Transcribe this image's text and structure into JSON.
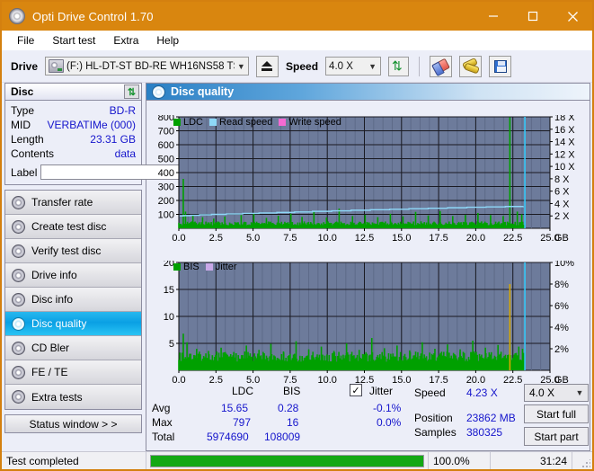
{
  "window": {
    "title": "Opti Drive Control 1.70",
    "icon": "disc-icon",
    "minimize": "minimize-icon",
    "maximize": "maximize-icon",
    "close": "close-icon"
  },
  "menu": [
    "File",
    "Start test",
    "Extra",
    "Help"
  ],
  "toolbar": {
    "drive_label": "Drive",
    "drive_value": "(F:)  HL-DT-ST BD-RE  WH16NS58 TST4",
    "eject_icon": "eject-icon",
    "speed_label": "Speed",
    "speed_value": "4.0 X",
    "refresh_icon": "refresh-icon",
    "eraser_icon": "eraser-icon",
    "tools_icon": "tools-icon",
    "save_icon": "save-icon"
  },
  "disc_panel": {
    "title": "Disc",
    "refresh_icon": "refresh-icon",
    "rows": [
      {
        "key": "Type",
        "value": "BD-R"
      },
      {
        "key": "MID",
        "value": "VERBATIMe (000)"
      },
      {
        "key": "Length",
        "value": "23.31 GB"
      },
      {
        "key": "Contents",
        "value": "data"
      }
    ],
    "label_key": "Label",
    "label_value": "",
    "label_placeholder": "",
    "disc_button_icon": "cd-icon"
  },
  "sidebar": {
    "items": [
      {
        "label": "Transfer rate",
        "active": false
      },
      {
        "label": "Create test disc",
        "active": false
      },
      {
        "label": "Verify test disc",
        "active": false
      },
      {
        "label": "Drive info",
        "active": false
      },
      {
        "label": "Disc info",
        "active": false
      },
      {
        "label": "Disc quality",
        "active": true
      },
      {
        "label": "CD Bler",
        "active": false
      },
      {
        "label": "FE / TE",
        "active": false
      },
      {
        "label": "Extra tests",
        "active": false
      }
    ],
    "status_window": "Status window > >"
  },
  "main": {
    "header": "Disc quality",
    "header_icon": "disc-quality-icon"
  },
  "chart_data": [
    {
      "id": "top-chart",
      "type": "area",
      "title": "",
      "xlabel": "GB",
      "ylabel": "",
      "xlim": [
        0.0,
        25.0
      ],
      "xticks": [
        "0.0",
        "2.5",
        "5.0",
        "7.5",
        "10.0",
        "12.5",
        "15.0",
        "17.5",
        "20.0",
        "22.5",
        "25.0"
      ],
      "x_unit": "GB",
      "ylim": [
        0,
        800
      ],
      "yticks": [
        "800",
        "700",
        "600",
        "500",
        "400",
        "300",
        "200",
        "100"
      ],
      "y2lim": [
        0,
        18
      ],
      "y2ticks": [
        "18 X",
        "16 X",
        "14 X",
        "12 X",
        "10 X",
        "8 X",
        "6 X",
        "4 X",
        "2 X"
      ],
      "grid": true,
      "legend_position": "top-left",
      "legend": [
        {
          "name": "LDC",
          "color": "#00a000"
        },
        {
          "name": "Read speed",
          "color": "#8ed8f8"
        },
        {
          "name": "Write speed",
          "color": "#f56ad2"
        }
      ],
      "series": [
        {
          "name": "LDC",
          "color": "#00a000",
          "axis": "left",
          "render": "spikes",
          "baseline": 22,
          "noise_amplitude": 28,
          "spikes": [
            [
              0.3,
              355
            ],
            [
              0.45,
              120
            ],
            [
              0.95,
              95
            ],
            [
              1.6,
              80
            ],
            [
              2.35,
              70
            ],
            [
              3.1,
              85
            ],
            [
              4.2,
              95
            ],
            [
              5.05,
              110
            ],
            [
              5.9,
              75
            ],
            [
              6.7,
              90
            ],
            [
              7.55,
              105
            ],
            [
              8.3,
              82
            ],
            [
              9.1,
              120
            ],
            [
              9.95,
              78
            ],
            [
              10.8,
              142
            ],
            [
              11.7,
              88
            ],
            [
              12.55,
              96
            ],
            [
              13.4,
              80
            ],
            [
              14.25,
              104
            ],
            [
              15.1,
              86
            ],
            [
              15.95,
              118
            ],
            [
              16.8,
              92
            ],
            [
              17.6,
              124
            ],
            [
              18.45,
              88
            ],
            [
              19.3,
              96
            ],
            [
              20.15,
              110
            ],
            [
              21.0,
              95
            ],
            [
              21.85,
              88
            ],
            [
              22.3,
              797
            ],
            [
              22.8,
              120
            ],
            [
              23.1,
              100
            ]
          ],
          "x_end": 23.31
        },
        {
          "name": "Read speed",
          "color": "#8ed8f8",
          "axis": "right",
          "render": "step-line",
          "points": [
            [
              0.05,
              2.0
            ],
            [
              0.3,
              2.05
            ],
            [
              0.8,
              2.1
            ],
            [
              1.4,
              2.18
            ],
            [
              2.2,
              2.25
            ],
            [
              3.2,
              2.32
            ],
            [
              4.3,
              2.4
            ],
            [
              5.4,
              2.48
            ],
            [
              6.6,
              2.56
            ],
            [
              7.8,
              2.64
            ],
            [
              9.0,
              2.74
            ],
            [
              10.3,
              2.82
            ],
            [
              11.6,
              2.92
            ],
            [
              12.9,
              3.0
            ],
            [
              14.2,
              3.08
            ],
            [
              15.5,
              3.16
            ],
            [
              16.8,
              3.24
            ],
            [
              18.1,
              3.32
            ],
            [
              19.4,
              3.4
            ],
            [
              20.7,
              3.46
            ],
            [
              22.0,
              3.52
            ],
            [
              23.2,
              3.56
            ]
          ]
        },
        {
          "name": "Write speed",
          "color": "#f56ad2",
          "axis": "right",
          "render": "none",
          "points": []
        }
      ],
      "markers": [
        {
          "name": "end-of-data",
          "x": 23.31,
          "color": "#35c8f8"
        }
      ]
    },
    {
      "id": "bottom-chart",
      "type": "area",
      "title": "",
      "xlabel": "GB",
      "ylabel": "",
      "xlim": [
        0.0,
        25.0
      ],
      "xticks": [
        "0.0",
        "2.5",
        "5.0",
        "7.5",
        "10.0",
        "12.5",
        "15.0",
        "17.5",
        "20.0",
        "22.5",
        "25.0"
      ],
      "x_unit": "GB",
      "ylim": [
        0,
        20
      ],
      "yticks": [
        "20",
        "15",
        "10",
        "5"
      ],
      "y2lim": [
        0,
        10
      ],
      "y2ticks": [
        "10%",
        "8%",
        "6%",
        "4%",
        "2%"
      ],
      "grid": true,
      "legend_position": "top-left",
      "legend": [
        {
          "name": "BIS",
          "color": "#00a000"
        },
        {
          "name": "Jitter",
          "color": "#c9a8e8"
        }
      ],
      "series": [
        {
          "name": "BIS",
          "color": "#00a000",
          "axis": "left",
          "render": "spikes",
          "baseline": 1.6,
          "noise_amplitude": 1.9,
          "spikes": [
            [
              0.3,
              6.8
            ],
            [
              0.55,
              5.2
            ],
            [
              1.2,
              4.0
            ],
            [
              2.0,
              3.6
            ],
            [
              2.85,
              4.2
            ],
            [
              3.7,
              3.4
            ],
            [
              4.55,
              4.6
            ],
            [
              5.4,
              3.8
            ],
            [
              6.2,
              4.9
            ],
            [
              7.05,
              3.5
            ],
            [
              7.9,
              5.4
            ],
            [
              8.75,
              3.9
            ],
            [
              9.6,
              4.4
            ],
            [
              10.45,
              3.6
            ],
            [
              11.3,
              5.0
            ],
            [
              12.15,
              3.8
            ],
            [
              13.0,
              6.0
            ],
            [
              13.85,
              4.1
            ],
            [
              14.7,
              4.6
            ],
            [
              15.55,
              3.7
            ],
            [
              16.4,
              5.2
            ],
            [
              17.25,
              4.0
            ],
            [
              18.1,
              4.8
            ],
            [
              18.95,
              3.9
            ],
            [
              19.8,
              5.5
            ],
            [
              20.65,
              4.2
            ],
            [
              21.5,
              4.7
            ],
            [
              22.3,
              5.1
            ],
            [
              22.9,
              4.4
            ],
            [
              23.15,
              4.0
            ]
          ],
          "x_end": 23.31
        },
        {
          "name": "Jitter",
          "color": "#d8a800",
          "axis": "left",
          "render": "spikes",
          "spikes": [
            [
              22.3,
              16.0
            ]
          ]
        }
      ],
      "markers": [
        {
          "name": "end-of-data",
          "x": 23.31,
          "color": "#35c8f8"
        }
      ]
    }
  ],
  "stats": {
    "col_headers": [
      "LDC",
      "BIS"
    ],
    "jitter_label": "Jitter",
    "jitter_checked": true,
    "rows": [
      {
        "label": "Avg",
        "ldc": "15.65",
        "bis": "0.28",
        "jitter": "-0.1%"
      },
      {
        "label": "Max",
        "ldc": "797",
        "bis": "16",
        "jitter": "0.0%"
      },
      {
        "label": "Total",
        "ldc": "5974690",
        "bis": "108009",
        "jitter": ""
      }
    ]
  },
  "readout": {
    "speed_label": "Speed",
    "speed_value": "4.23 X",
    "speed_select": "4.0 X",
    "position_label": "Position",
    "position_value": "23862 MB",
    "samples_label": "Samples",
    "samples_value": "380325",
    "start_full": "Start full",
    "start_part": "Start part"
  },
  "statusbar": {
    "message": "Test completed",
    "progress_percent": "100.0%",
    "progress_value": 100,
    "elapsed": "31:24"
  }
}
